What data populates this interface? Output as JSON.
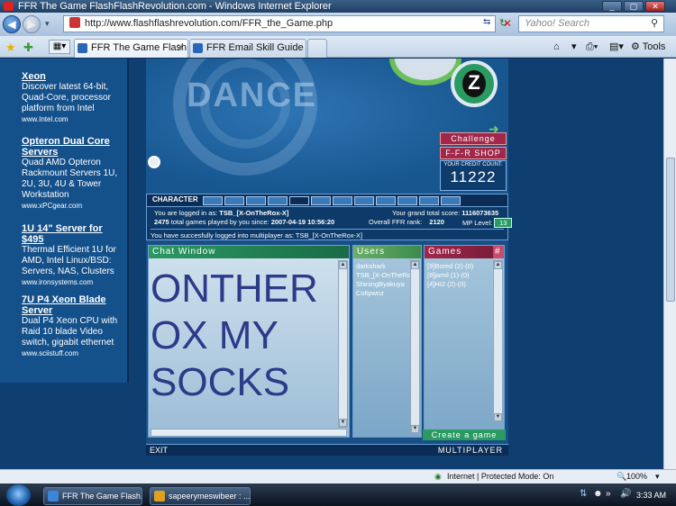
{
  "window": {
    "title": "FFR The Game FlashFlashRevolution.com - Windows Internet Explorer"
  },
  "browser": {
    "url": "http://www.flashflashrevolution.com/FFR_the_Game.php",
    "search_placeholder": "Yahoo! Search",
    "tabs": [
      {
        "label": "FFR The Game FlashFla..."
      },
      {
        "label": "FFR Email Skill Guide Probl..."
      }
    ],
    "toolbar_tools_label": "Tools",
    "status_zone": "Internet | Protected Mode: On",
    "zoom": "100%"
  },
  "ads": [
    {
      "title": "Xeon",
      "text": "Discover latest 64-bit, Quad-Core, processor platform from Intel",
      "url": "www.Intel.com"
    },
    {
      "title": "Opteron Dual Core Servers",
      "text": "Quad AMD Opteron Rackmount Servers 1U, 2U, 3U, 4U & Tower Workstation",
      "url": "www.xPCgear.com"
    },
    {
      "title": "1U 14\" Server for $495",
      "text": "Thermal Efficient 1U for AMD, Intel Linux/BSD: Servers, NAS, Clusters",
      "url": "www.ironsystems.com"
    },
    {
      "title": "7U P4 Xeon Blade Server",
      "text": "Dual P4 Xeon CPU with Raid 10 blade Video switch, gigabit ethernet",
      "url": "www.sciistuff.com"
    }
  ],
  "game": {
    "hero_title": "DANCE",
    "challenge_label": "Challenge",
    "shop_label": "F-F-R SHOP",
    "credit_label": "YOUR CREDIT COUNT:",
    "credit_count": "11222",
    "character_label": "CHARACTER",
    "logged_in_label": "You are logged in as:",
    "username": "TSB_[X-OnTheRox-X]",
    "games_played_count": "2475",
    "games_played_text": "total games played by you since:",
    "since_date": "2007-04-19 10:56:20",
    "grand_total_label": "Your grand total score:",
    "grand_total": "1116073635",
    "rank_label": "Overall FFR rank:",
    "rank": "2120",
    "mp_level_label": "MP Level:",
    "mp_level": "13",
    "login_msg": "You have succesfully logged into multiplayer as: TSB_[X-OnTheRox-X]",
    "chat_title": "Chat Window",
    "chat_text": [
      "ONTHER",
      "OX MY",
      "SOCKS"
    ],
    "users_title": "Users",
    "users": [
      "darkshark",
      "TSB_[X-OnTheRo",
      "ShiningByakuya",
      "Coltpwnz"
    ],
    "games_title": "Games",
    "games_hash": "#",
    "games": [
      "[9]Bored (2)-(0)",
      "[8]jamil (1)-(0)",
      "[4]HI2 (2)-(0)"
    ],
    "create_label": "Create a game",
    "exit_label": "EXIT",
    "multiplayer_label": "MULTIPLAYER"
  },
  "taskbar": {
    "items": [
      {
        "label": "FFR The Game Flash..."
      },
      {
        "label": "sapeerymeswibeer : ..."
      }
    ],
    "time": "3:33 AM"
  }
}
